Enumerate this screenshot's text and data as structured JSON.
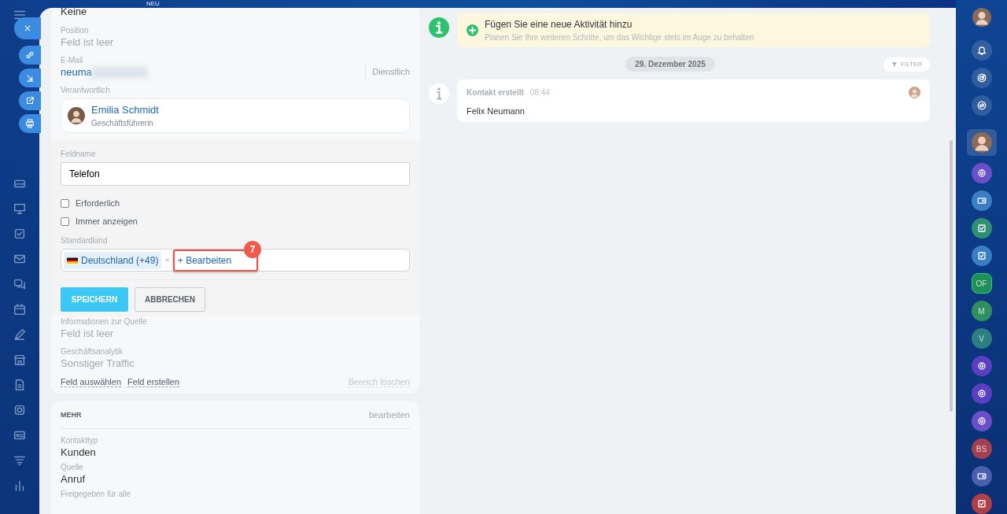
{
  "header": {
    "badge": "NEU"
  },
  "contact_card": {
    "fields_top": [
      {
        "value": "Keine",
        "empty": false
      },
      {
        "label": "Position",
        "value": "Feld ist leer",
        "empty": true
      }
    ],
    "email": {
      "label": "E-Mail",
      "value": "neuma",
      "type": "Dienstlich"
    },
    "responsible": {
      "label": "Verantwortlich",
      "name": "Emilia Schmidt",
      "role": "Geschäftsführerin"
    },
    "editor": {
      "name_label": "Feldname",
      "name_value": "Telefon",
      "options": [
        {
          "label": "Erforderlich",
          "checked": false
        },
        {
          "label": "Immer anzeigen",
          "checked": false
        }
      ],
      "country_label": "Standardland",
      "tag": "Deutschland (+49)",
      "tag_remove": "×",
      "add_link": "+ Bearbeiten",
      "callout": "7",
      "buttons": [
        {
          "label": "SPEICHERN",
          "kind": "primary"
        },
        {
          "label": "ABBRECHEN",
          "kind": "secondary"
        }
      ]
    },
    "fields_bottom": [
      {
        "label": "Informationen zur Quelle",
        "value": "Feld ist leer",
        "empty": true
      },
      {
        "label": "Geschäftsanalytik",
        "value": "Sonstiger Traffic",
        "empty": true
      }
    ],
    "links": [
      {
        "label": "Feld auswählen",
        "disabled": false
      },
      {
        "label": "Feld erstellen",
        "disabled": false
      },
      {
        "label": "Bereich löschen",
        "disabled": true
      }
    ]
  },
  "more_card": {
    "title": "MEHR",
    "action": "bearbeiten",
    "fields": [
      {
        "label": "Kontakttyp",
        "value": "Kunden"
      },
      {
        "label": "Quelle",
        "value": "Anruf"
      },
      {
        "label": "Freigegeben für alle"
      }
    ]
  },
  "timeline": {
    "new_activity": {
      "title": "Fügen Sie eine neue Aktivität hinzu",
      "hint": "Planen Sie Ihre weiteren Schritte, um das Wichtige stets im Auge zu behalten"
    },
    "date": "29. Dezember 2025",
    "filter": "FILTER",
    "entries": [
      {
        "title": "Kontakt erstellt",
        "time": "08:44",
        "text": "Felix Neumann"
      }
    ]
  },
  "rightbar": {
    "items": [
      {
        "kind": "avatar",
        "selected": false
      },
      {
        "kind": "bell"
      },
      {
        "kind": "target"
      },
      {
        "kind": "chat"
      },
      {
        "kind": "avatar",
        "selected": true
      },
      {
        "kind": "app",
        "color": "#6a4fc8"
      },
      {
        "kind": "card",
        "color": "#3a7fc4"
      },
      {
        "kind": "check",
        "color": "#2f8f74"
      },
      {
        "kind": "check",
        "color": "#3a7fc4"
      },
      {
        "kind": "hex",
        "color": "#1f8f5a",
        "label": "OF"
      },
      {
        "kind": "initials",
        "color": "#2f8f5e",
        "label": "M"
      },
      {
        "kind": "initials",
        "color": "#2a7f80",
        "label": "V"
      },
      {
        "kind": "app",
        "color": "#5a3fc0"
      },
      {
        "kind": "app",
        "color": "#5a3fc0"
      },
      {
        "kind": "app",
        "color": "#6a4fc8"
      },
      {
        "kind": "initials",
        "color": "#a04050",
        "label": "BS"
      },
      {
        "kind": "card",
        "color": "#4a5fb0"
      },
      {
        "kind": "check",
        "color": "#b04048"
      }
    ]
  }
}
